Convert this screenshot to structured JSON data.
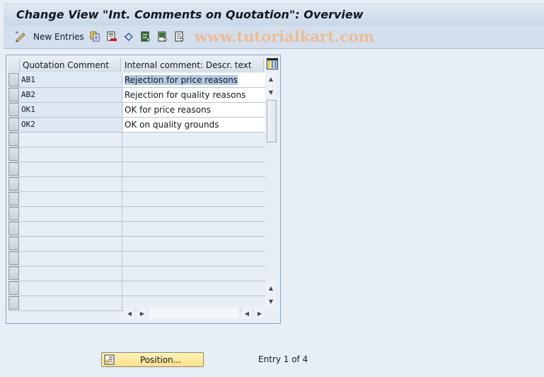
{
  "title": "Change View \"Int. Comments on Quotation\": Overview",
  "toolbar": {
    "new_entries_label": "New Entries",
    "icons": [
      "edit-pencil-icon",
      "copy-icon",
      "delete-icon",
      "undo-icon",
      "select-all-icon",
      "select-block-icon",
      "deselect-all-icon"
    ]
  },
  "watermark": "www.tutorialkart.com",
  "table": {
    "columns": [
      "Quotation Comment",
      "Internal comment: Descr. text"
    ],
    "rows": [
      {
        "code": "AB1",
        "text": "Rejection for price reasons",
        "highlighted": true
      },
      {
        "code": "AB2",
        "text": "Rejection for quality reasons"
      },
      {
        "code": "OK1",
        "text": "OK for price reasons"
      },
      {
        "code": "OK2",
        "text": "OK on quality grounds"
      }
    ],
    "empty_rows": 12
  },
  "footer": {
    "position_button": "Position...",
    "entry_text": "Entry 1 of 4"
  }
}
